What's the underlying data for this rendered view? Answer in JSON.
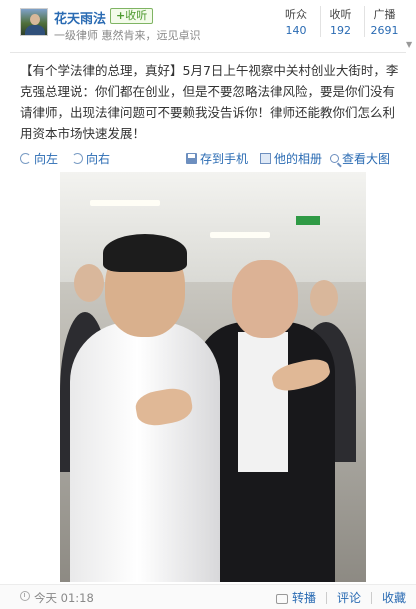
{
  "user": {
    "name": "花天雨法",
    "follow_label": "收听",
    "follow_plus": "+",
    "description": "一级律师 惠然肯来，远见卓识"
  },
  "stats": [
    {
      "label": "听众",
      "value": "140"
    },
    {
      "label": "收听",
      "value": "192"
    },
    {
      "label": "广播",
      "value": "2691"
    }
  ],
  "post": {
    "text": "【有个学法律的总理，真好】5月7日上午视察中关村创业大街时，李克强总理说：你们都在创业，但是不要忽略法律风险，要是你们没有请律师，出现法律问题可不要赖我没告诉你！律师还能教你们怎么利用资本市场快速发展！"
  },
  "toolbar": {
    "rotate_left": "向左",
    "rotate_right": "向右",
    "save_to_phone": "存到手机",
    "his_album": "他的相册",
    "view_large": "查看大图"
  },
  "footer": {
    "time": "今天 01:18",
    "repost": "转播",
    "comment": "评论",
    "favorite": "收藏"
  },
  "colors": {
    "link": "#2a6bb3",
    "follow_green": "#4d9a2f"
  }
}
